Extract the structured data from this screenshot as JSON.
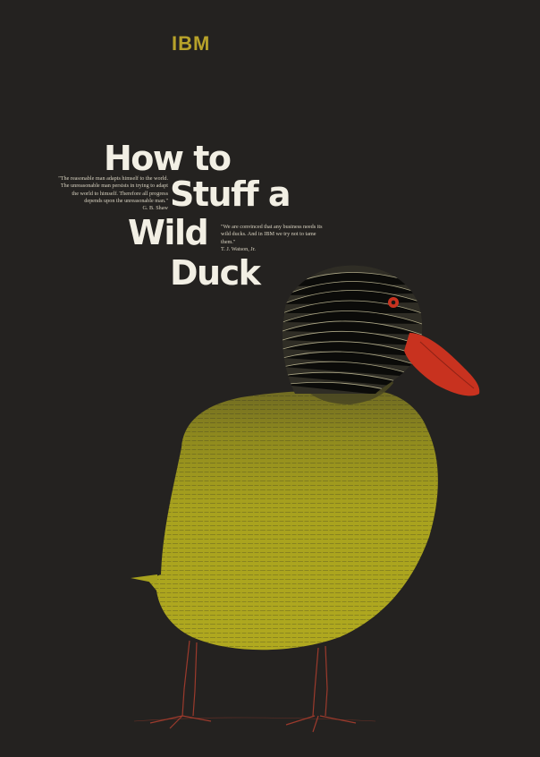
{
  "brand": "IBM",
  "title": [
    "How to",
    "Stuff a",
    "Wild",
    "Duck"
  ],
  "quote_left": {
    "text": "\"The reasonable man adapts himself to the world. The unreasonable man persists in trying to adapt the world to himself. Therefore all progress depends upon the unreasonable man.\"",
    "attribution": "G. B. Shaw"
  },
  "quote_right": {
    "text": "\"We are convinced that any business needs its wild ducks. And in IBM we try not to tame them.\"",
    "attribution": "T. J. Watson, Jr."
  },
  "colors": {
    "background": "#242220",
    "brand": "#b7a22a",
    "title": "#f2efe4",
    "duck_head_text": "#d9d2a8",
    "duck_body": "#a8a21e",
    "beak": "#c8321f",
    "eye": "#c8321f",
    "legs": "#9b3a2c"
  },
  "duck_words": "Don't fight City Hall Easy does it It doesn't matter Not my responsibility Be Practical We tried that Overruled Lead time Committees Rules Rules Politics Stay on their good side Be competitive CYA Standards Convention Hierarchy Proprietary Precedence You Ought Tradition Inflexibility Bureaucracy What's Kingston doing? Who's above you? Here we go again Document that Have you checked with Let's run it by Ed Policy Consistency Over-control Operating Procedures One step at a time Marketing says Experienced judgement Never happen Business reasons say Convention Draft a memo Chain of command Work Week Stay on their good side Attitude Review Yes but Intolerance Budget"
}
